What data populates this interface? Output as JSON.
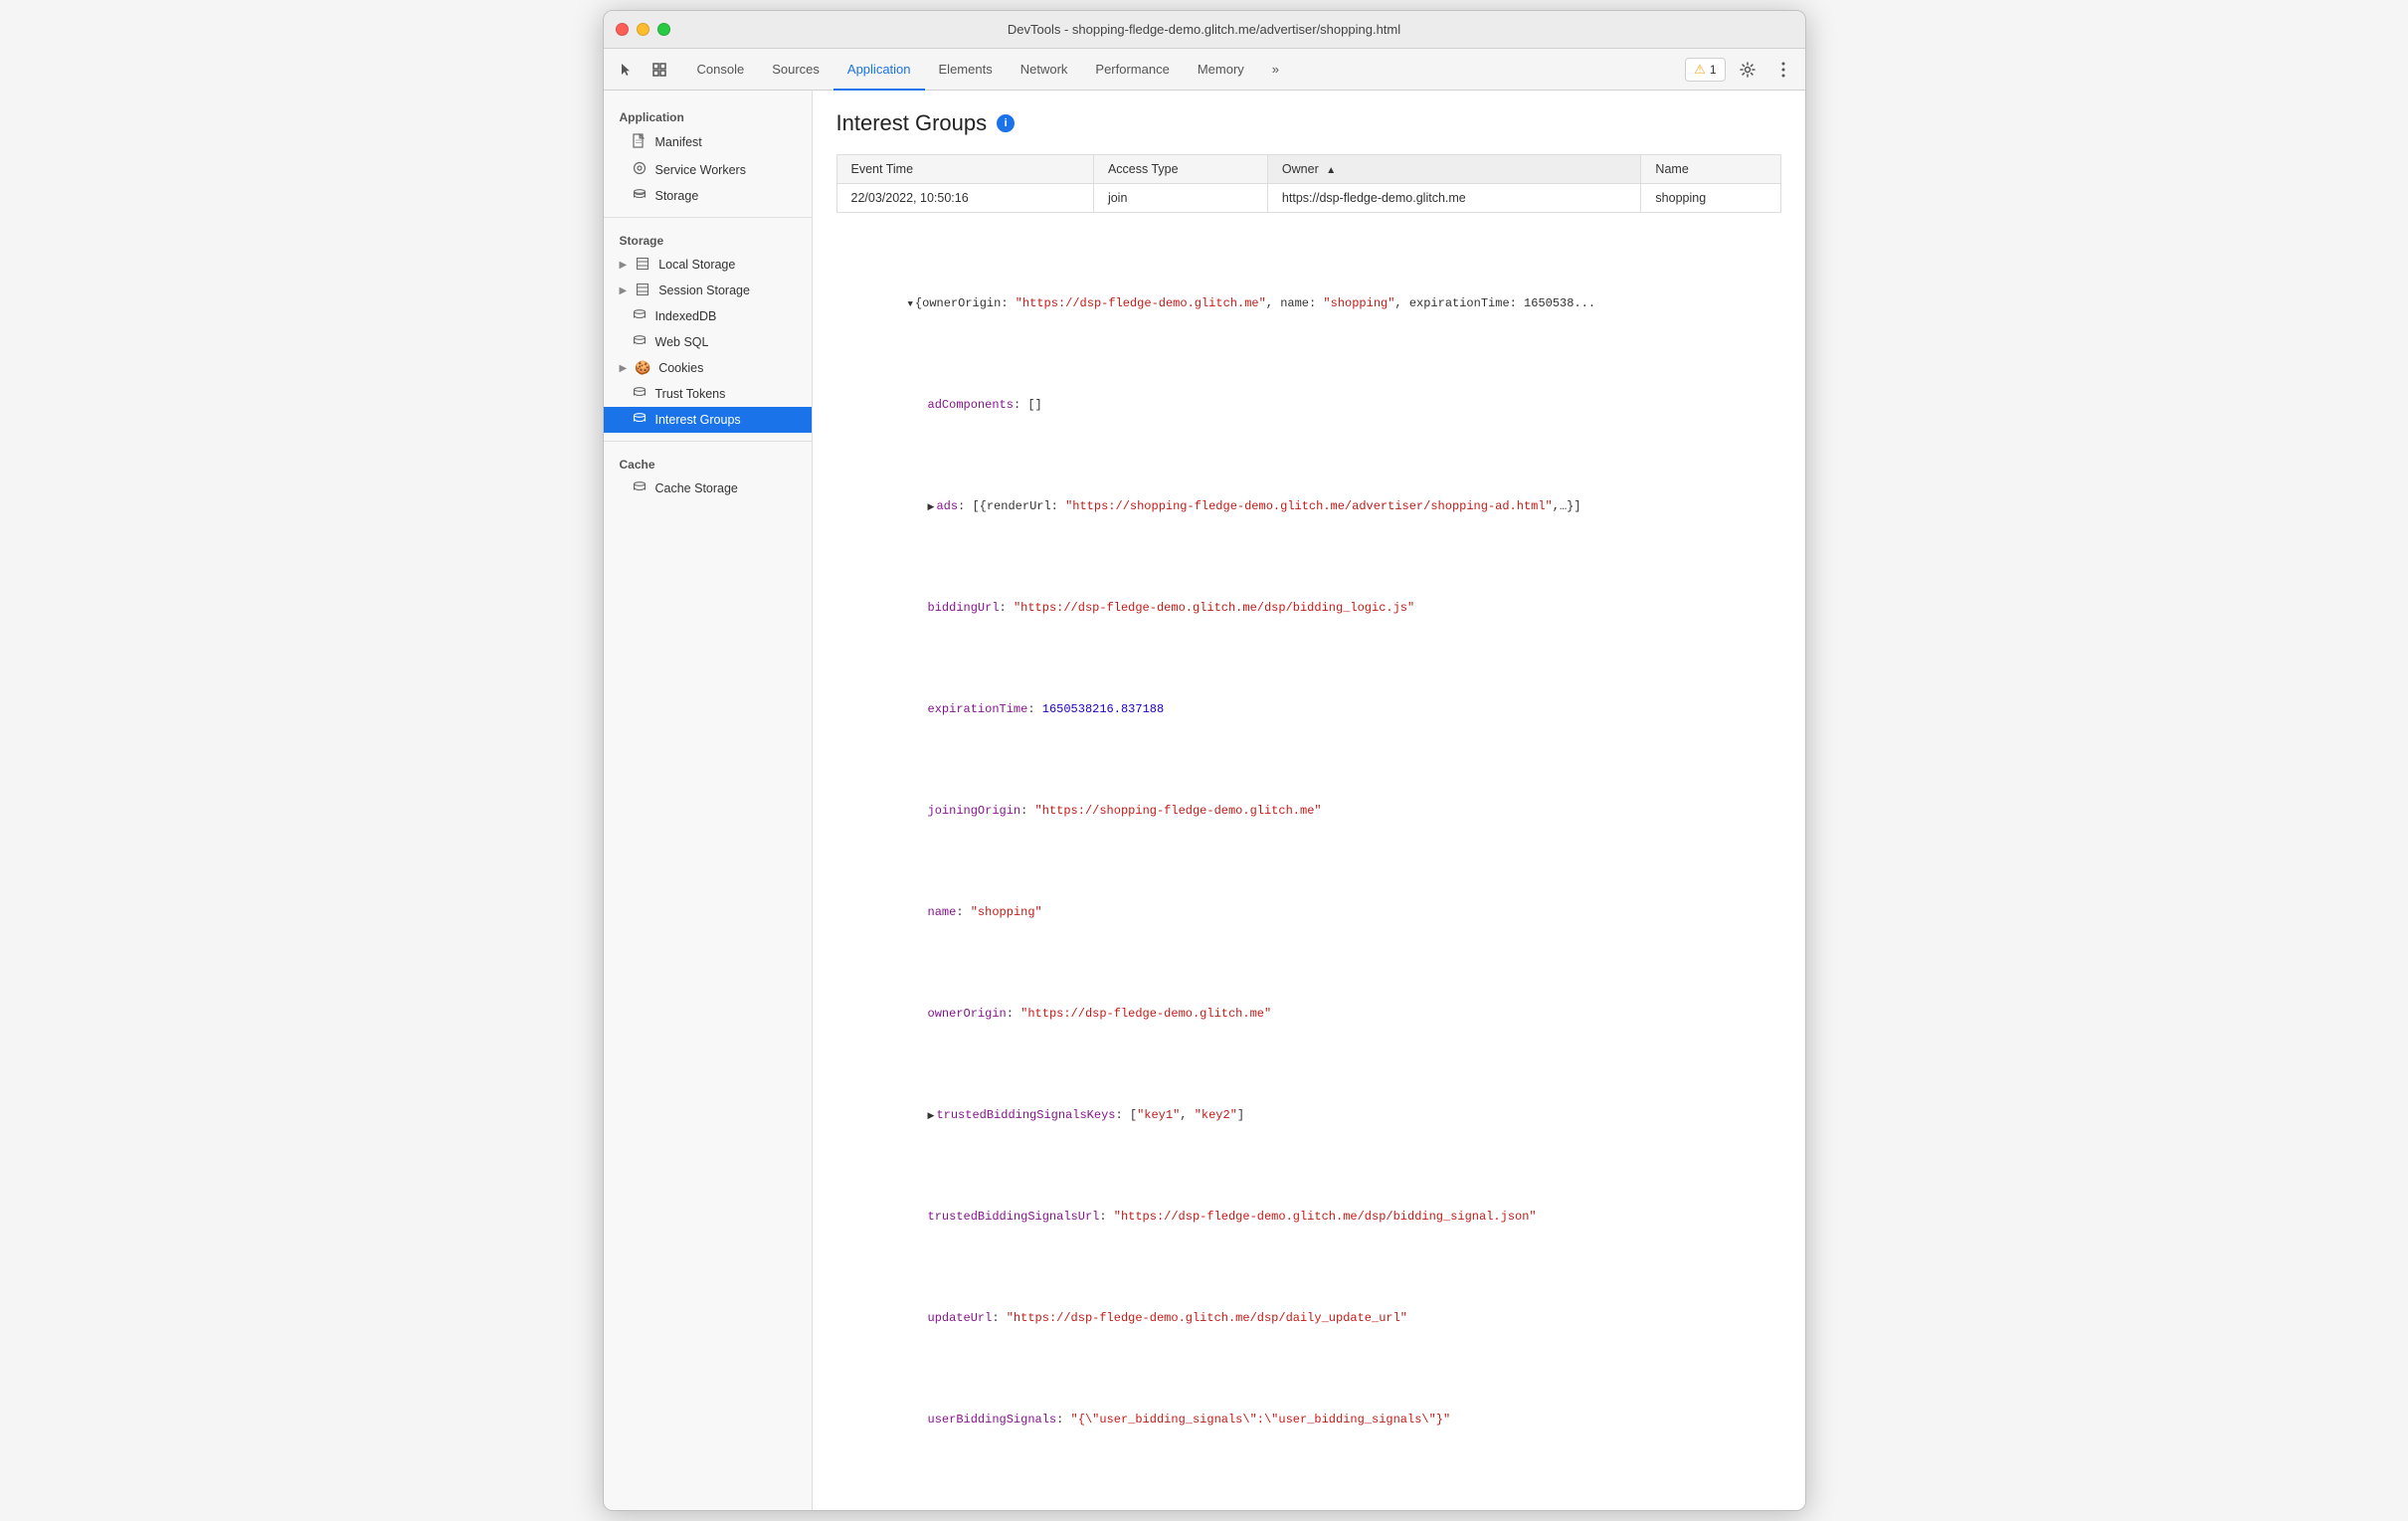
{
  "titlebar": {
    "title": "DevTools - shopping-fledge-demo.glitch.me/advertiser/shopping.html"
  },
  "toolbar": {
    "tabs": [
      {
        "id": "console",
        "label": "Console",
        "active": false
      },
      {
        "id": "sources",
        "label": "Sources",
        "active": false
      },
      {
        "id": "application",
        "label": "Application",
        "active": true
      },
      {
        "id": "elements",
        "label": "Elements",
        "active": false
      },
      {
        "id": "network",
        "label": "Network",
        "active": false
      },
      {
        "id": "performance",
        "label": "Performance",
        "active": false
      },
      {
        "id": "memory",
        "label": "Memory",
        "active": false
      },
      {
        "id": "more",
        "label": "»",
        "active": false
      }
    ],
    "warning_count": "1",
    "warning_label": "1"
  },
  "sidebar": {
    "application_section": "Application",
    "items_application": [
      {
        "id": "manifest",
        "label": "Manifest",
        "icon": "📄"
      },
      {
        "id": "service-workers",
        "label": "Service Workers",
        "icon": "⚙"
      },
      {
        "id": "storage",
        "label": "Storage",
        "icon": "🗄"
      }
    ],
    "storage_section": "Storage",
    "items_storage": [
      {
        "id": "local-storage",
        "label": "Local Storage",
        "icon": "▦",
        "expandable": true
      },
      {
        "id": "session-storage",
        "label": "Session Storage",
        "icon": "▦",
        "expandable": true
      },
      {
        "id": "indexeddb",
        "label": "IndexedDB",
        "icon": "🗄"
      },
      {
        "id": "web-sql",
        "label": "Web SQL",
        "icon": "🗄"
      },
      {
        "id": "cookies",
        "label": "Cookies",
        "icon": "🍪",
        "expandable": true
      },
      {
        "id": "trust-tokens",
        "label": "Trust Tokens",
        "icon": "🗄"
      },
      {
        "id": "interest-groups",
        "label": "Interest Groups",
        "icon": "🗄",
        "active": true
      }
    ],
    "cache_section": "Cache",
    "items_cache": [
      {
        "id": "cache-storage",
        "label": "Cache Storage",
        "icon": "🗄"
      }
    ]
  },
  "main": {
    "page_title": "Interest Groups",
    "table": {
      "columns": [
        {
          "id": "event-time",
          "label": "Event Time",
          "sortable": false
        },
        {
          "id": "access-type",
          "label": "Access Type",
          "sortable": false
        },
        {
          "id": "owner",
          "label": "Owner",
          "sortable": true,
          "sorted": true,
          "sort_dir": "asc"
        },
        {
          "id": "name",
          "label": "Name",
          "sortable": false
        }
      ],
      "rows": [
        {
          "event_time": "22/03/2022, 10:50:16",
          "access_type": "join",
          "owner": "https://dsp-fledge-demo.glitch.me",
          "name": "shopping"
        }
      ]
    },
    "json_detail": {
      "root_label": "{ownerOrigin: \"https://dsp-fledge-demo.glitch.me\", name: \"shopping\", expirationTime: 1650538...",
      "lines": [
        {
          "indent": 1,
          "key": "adComponents",
          "value": "[]",
          "type": "array-empty"
        },
        {
          "indent": 1,
          "key": "ads",
          "value": "[{renderUrl: \"https://shopping-fledge-demo.glitch.me/advertiser/shopping-ad.html\",…}]",
          "type": "array-collapsed",
          "expandable": true
        },
        {
          "indent": 1,
          "key": "biddingUrl",
          "value": "\"https://dsp-fledge-demo.glitch.me/dsp/bidding_logic.js\"",
          "type": "string"
        },
        {
          "indent": 1,
          "key": "expirationTime",
          "value": "1650538216.837188",
          "type": "number"
        },
        {
          "indent": 1,
          "key": "joiningOrigin",
          "value": "\"https://shopping-fledge-demo.glitch.me\"",
          "type": "string"
        },
        {
          "indent": 1,
          "key": "name",
          "value": "\"shopping\"",
          "type": "string"
        },
        {
          "indent": 1,
          "key": "ownerOrigin",
          "value": "\"https://dsp-fledge-demo.glitch.me\"",
          "type": "string"
        },
        {
          "indent": 1,
          "key": "trustedBiddingSignalsKeys",
          "value": "[\"key1\", \"key2\"]",
          "type": "array-collapsed",
          "expandable": true
        },
        {
          "indent": 1,
          "key": "trustedBiddingSignalsUrl",
          "value": "\"https://dsp-fledge-demo.glitch.me/dsp/bidding_signal.json\"",
          "type": "string"
        },
        {
          "indent": 1,
          "key": "updateUrl",
          "value": "\"https://dsp-fledge-demo.glitch.me/dsp/daily_update_url\"",
          "type": "string"
        },
        {
          "indent": 1,
          "key": "userBiddingSignals",
          "value": "\"{\\\"user_bidding_signals\\\":\\\"user_bidding_signals\\\"}\"",
          "type": "string"
        }
      ]
    }
  }
}
